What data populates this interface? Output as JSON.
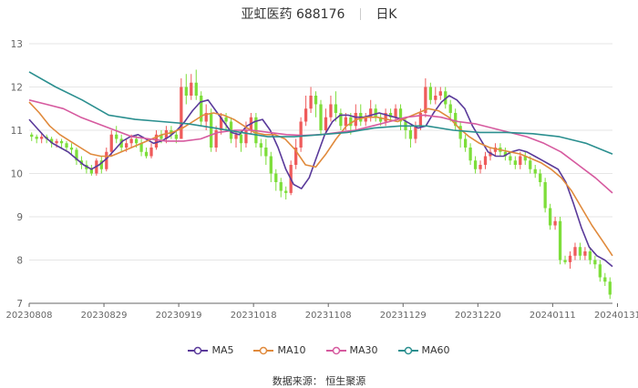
{
  "header": {
    "stock_name": "亚虹医药",
    "code": "688176",
    "period": "日K"
  },
  "source": "数据来源：  恒生聚源",
  "colors": {
    "up": "#ef5b5b",
    "down": "#7dde3a",
    "MA5": "#5a3a9a",
    "MA10": "#e08a3c",
    "MA30": "#d65a9f",
    "MA60": "#2b8f8f",
    "grid": "#e6e6e6",
    "axis": "#666666"
  },
  "chart_data": {
    "type": "candlestick",
    "title": "亚虹医药 688176 日K",
    "ylim": [
      7,
      13
    ],
    "yticks": [
      7,
      8,
      9,
      10,
      11,
      12,
      13
    ],
    "grid": true,
    "legend_position": "bottom",
    "x_tick_labels": [
      "20230808",
      "20230829",
      "20230919",
      "20231018",
      "20231108",
      "20231129",
      "20231220",
      "20240111",
      "20240131"
    ],
    "x_tick_index": [
      0,
      15,
      30,
      45,
      60,
      75,
      90,
      105,
      118
    ],
    "dates": [
      "20230808",
      "20230809",
      "20230810",
      "20230811",
      "20230814",
      "20230815",
      "20230816",
      "20230817",
      "20230818",
      "20230821",
      "20230822",
      "20230823",
      "20230824",
      "20230825",
      "20230828",
      "20230829",
      "20230830",
      "20230831",
      "20230901",
      "20230904",
      "20230905",
      "20230906",
      "20230907",
      "20230908",
      "20230911",
      "20230912",
      "20230913",
      "20230914",
      "20230915",
      "20230918",
      "20230919",
      "20230920",
      "20230921",
      "20230922",
      "20230925",
      "20230926",
      "20230927",
      "20230928",
      "20231009",
      "20231010",
      "20231011",
      "20231012",
      "20231013",
      "20231016",
      "20231017",
      "20231018",
      "20231019",
      "20231020",
      "20231023",
      "20231024",
      "20231025",
      "20231026",
      "20231027",
      "20231030",
      "20231031",
      "20231101",
      "20231102",
      "20231103",
      "20231106",
      "20231107",
      "20231108",
      "20231109",
      "20231110",
      "20231113",
      "20231114",
      "20231115",
      "20231116",
      "20231117",
      "20231120",
      "20231121",
      "20231122",
      "20231123",
      "20231124",
      "20231127",
      "20231128",
      "20231129",
      "20231130",
      "20231201",
      "20231204",
      "20231205",
      "20231206",
      "20231207",
      "20231208",
      "20231211",
      "20231212",
      "20231213",
      "20231214",
      "20231215",
      "20231218",
      "20231219",
      "20231220",
      "20231221",
      "20231222",
      "20231225",
      "20231226",
      "20231227",
      "20231228",
      "20231229",
      "20240102",
      "20240103",
      "20240104",
      "20240105",
      "20240108",
      "20240109",
      "20240110",
      "20240111",
      "20240112",
      "20240115",
      "20240116",
      "20240117",
      "20240118",
      "20240119",
      "20240122",
      "20240123",
      "20240124",
      "20240125",
      "20240126",
      "20240129",
      "20240131"
    ],
    "candles": [
      [
        10.9,
        10.85,
        10.95,
        10.75
      ],
      [
        10.85,
        10.8,
        10.9,
        10.7
      ],
      [
        10.8,
        10.85,
        10.95,
        10.7
      ],
      [
        10.85,
        10.8,
        10.9,
        10.7
      ],
      [
        10.8,
        10.7,
        10.85,
        10.6
      ],
      [
        10.7,
        10.75,
        10.8,
        10.6
      ],
      [
        10.75,
        10.7,
        10.8,
        10.6
      ],
      [
        10.7,
        10.6,
        10.75,
        10.5
      ],
      [
        10.6,
        10.55,
        10.7,
        10.45
      ],
      [
        10.55,
        10.3,
        10.6,
        10.2
      ],
      [
        10.3,
        10.2,
        10.4,
        10.1
      ],
      [
        10.2,
        10.1,
        10.3,
        10.0
      ],
      [
        10.1,
        10.0,
        10.2,
        9.95
      ],
      [
        10.0,
        10.3,
        10.35,
        9.95
      ],
      [
        10.3,
        10.1,
        10.4,
        10.0
      ],
      [
        10.1,
        10.5,
        10.6,
        10.05
      ],
      [
        10.5,
        10.9,
        11.0,
        10.4
      ],
      [
        10.9,
        10.8,
        11.1,
        10.7
      ],
      [
        10.8,
        10.6,
        10.9,
        10.5
      ],
      [
        10.6,
        10.7,
        10.8,
        10.5
      ],
      [
        10.7,
        10.8,
        10.9,
        10.6
      ],
      [
        10.8,
        10.7,
        10.9,
        10.6
      ],
      [
        10.7,
        10.5,
        10.8,
        10.4
      ],
      [
        10.5,
        10.4,
        10.6,
        10.35
      ],
      [
        10.4,
        10.6,
        10.7,
        10.35
      ],
      [
        10.6,
        10.9,
        11.0,
        10.55
      ],
      [
        10.9,
        10.8,
        11.0,
        10.7
      ],
      [
        10.8,
        11.0,
        11.1,
        10.7
      ],
      [
        11.0,
        10.9,
        11.1,
        10.8
      ],
      [
        10.9,
        10.8,
        11.0,
        10.7
      ],
      [
        10.8,
        12.0,
        12.2,
        10.8
      ],
      [
        12.0,
        11.8,
        12.3,
        11.6
      ],
      [
        11.8,
        12.1,
        12.3,
        11.7
      ],
      [
        12.1,
        11.8,
        12.4,
        11.7
      ],
      [
        11.8,
        11.2,
        11.9,
        11.1
      ],
      [
        11.2,
        11.4,
        11.6,
        11.0
      ],
      [
        11.4,
        10.6,
        11.5,
        10.5
      ],
      [
        10.6,
        11.0,
        11.1,
        10.5
      ],
      [
        11.0,
        11.3,
        11.4,
        10.9
      ],
      [
        11.3,
        11.2,
        11.4,
        11.0
      ],
      [
        11.2,
        10.8,
        11.3,
        10.7
      ],
      [
        10.8,
        10.9,
        11.0,
        10.6
      ],
      [
        10.9,
        10.7,
        11.0,
        10.5
      ],
      [
        10.7,
        11.0,
        11.2,
        10.6
      ],
      [
        11.0,
        11.3,
        11.4,
        10.9
      ],
      [
        11.3,
        10.7,
        11.4,
        10.6
      ],
      [
        10.7,
        10.6,
        10.8,
        10.4
      ],
      [
        10.6,
        10.4,
        10.8,
        10.2
      ],
      [
        10.4,
        10.0,
        10.5,
        9.8
      ],
      [
        10.0,
        9.8,
        10.1,
        9.6
      ],
      [
        9.8,
        9.6,
        9.9,
        9.45
      ],
      [
        9.6,
        9.55,
        9.7,
        9.4
      ],
      [
        9.55,
        10.2,
        10.3,
        9.5
      ],
      [
        10.2,
        10.6,
        10.8,
        10.1
      ],
      [
        10.6,
        11.2,
        11.3,
        10.5
      ],
      [
        11.2,
        11.5,
        11.8,
        11.1
      ],
      [
        11.5,
        11.8,
        12.0,
        11.4
      ],
      [
        11.8,
        11.6,
        11.9,
        11.3
      ],
      [
        11.6,
        11.0,
        11.7,
        10.9
      ],
      [
        11.0,
        11.3,
        11.5,
        10.9
      ],
      [
        11.3,
        11.6,
        11.8,
        11.2
      ],
      [
        11.6,
        11.4,
        11.9,
        11.2
      ],
      [
        11.4,
        11.1,
        11.5,
        11.0
      ],
      [
        11.1,
        11.3,
        11.4,
        11.0
      ],
      [
        11.3,
        11.1,
        11.4,
        10.9
      ],
      [
        11.1,
        11.4,
        11.6,
        11.0
      ],
      [
        11.4,
        11.2,
        11.6,
        11.1
      ],
      [
        11.2,
        11.3,
        11.4,
        11.1
      ],
      [
        11.3,
        11.5,
        11.7,
        11.2
      ],
      [
        11.5,
        11.3,
        11.6,
        11.2
      ],
      [
        11.3,
        11.2,
        11.4,
        11.1
      ],
      [
        11.2,
        11.4,
        11.5,
        11.1
      ],
      [
        11.4,
        11.3,
        11.5,
        11.2
      ],
      [
        11.3,
        11.5,
        11.6,
        11.2
      ],
      [
        11.5,
        11.2,
        11.6,
        11.0
      ],
      [
        11.2,
        11.0,
        11.3,
        10.8
      ],
      [
        11.0,
        10.8,
        11.1,
        10.6
      ],
      [
        10.8,
        11.1,
        11.2,
        10.7
      ],
      [
        11.1,
        11.4,
        11.5,
        11.0
      ],
      [
        11.4,
        12.0,
        12.2,
        11.3
      ],
      [
        12.0,
        11.7,
        12.1,
        11.6
      ],
      [
        11.7,
        11.8,
        12.0,
        11.6
      ],
      [
        11.8,
        11.9,
        12.0,
        11.7
      ],
      [
        11.9,
        11.6,
        12.0,
        11.5
      ],
      [
        11.6,
        11.4,
        11.7,
        11.2
      ],
      [
        11.4,
        11.1,
        11.5,
        11.0
      ],
      [
        11.1,
        10.8,
        11.2,
        10.6
      ],
      [
        10.8,
        10.6,
        10.9,
        10.5
      ],
      [
        10.6,
        10.3,
        10.7,
        10.2
      ],
      [
        10.3,
        10.1,
        10.4,
        10.0
      ],
      [
        10.1,
        10.2,
        10.3,
        10.0
      ],
      [
        10.2,
        10.4,
        10.5,
        10.1
      ],
      [
        10.4,
        10.5,
        10.6,
        10.3
      ],
      [
        10.5,
        10.6,
        10.7,
        10.4
      ],
      [
        10.6,
        10.5,
        10.7,
        10.4
      ],
      [
        10.5,
        10.4,
        10.6,
        10.3
      ],
      [
        10.4,
        10.3,
        10.5,
        10.2
      ],
      [
        10.3,
        10.2,
        10.4,
        10.1
      ],
      [
        10.2,
        10.4,
        10.5,
        10.1
      ],
      [
        10.4,
        10.3,
        10.5,
        10.2
      ],
      [
        10.3,
        10.1,
        10.4,
        10.0
      ],
      [
        10.1,
        10.0,
        10.2,
        9.9
      ],
      [
        10.0,
        9.8,
        10.1,
        9.7
      ],
      [
        9.8,
        9.2,
        9.9,
        9.1
      ],
      [
        9.2,
        8.8,
        9.3,
        8.7
      ],
      [
        8.8,
        8.9,
        9.0,
        8.7
      ],
      [
        8.9,
        8.0,
        9.0,
        7.9
      ],
      [
        8.0,
        7.95,
        8.1,
        7.9
      ],
      [
        7.95,
        8.1,
        8.2,
        7.8
      ],
      [
        8.1,
        8.3,
        8.4,
        8.0
      ],
      [
        8.3,
        8.1,
        8.4,
        8.0
      ],
      [
        8.1,
        8.2,
        8.3,
        8.0
      ],
      [
        8.2,
        8.0,
        8.3,
        7.9
      ],
      [
        8.0,
        7.9,
        8.1,
        7.8
      ],
      [
        7.9,
        7.6,
        8.0,
        7.5
      ],
      [
        7.6,
        7.5,
        7.7,
        7.4
      ],
      [
        7.5,
        7.2,
        7.6,
        7.1
      ]
    ],
    "series": [
      {
        "name": "MA5",
        "values": [
          11.25,
          11.05,
          10.85,
          10.7,
          10.6,
          10.5,
          10.35,
          10.2,
          10.1,
          10.2,
          10.35,
          10.55,
          10.75,
          10.85,
          10.9,
          10.8,
          10.7,
          10.75,
          10.85,
          11.0,
          11.2,
          11.45,
          11.65,
          11.7,
          11.45,
          11.2,
          10.95,
          10.9,
          11.1,
          11.2,
          11.25,
          11.0,
          10.6,
          10.1,
          9.75,
          9.65,
          9.9,
          10.4,
          10.9,
          11.2,
          11.35,
          11.35,
          11.3,
          11.3,
          11.35,
          11.4,
          11.35,
          11.3,
          11.25,
          11.15,
          11.05,
          11.1,
          11.4,
          11.65,
          11.8,
          11.7,
          11.5,
          11.1,
          10.8,
          10.5,
          10.4,
          10.4,
          10.5,
          10.55,
          10.5,
          10.4,
          10.3,
          10.2,
          10.1,
          9.8,
          9.3,
          8.75,
          8.3,
          8.1,
          8.0,
          7.85
        ]
      },
      {
        "name": "MA10",
        "values": [
          11.65,
          11.4,
          11.1,
          10.9,
          10.75,
          10.6,
          10.45,
          10.4,
          10.4,
          10.5,
          10.6,
          10.7,
          10.8,
          10.9,
          10.95,
          11.05,
          11.2,
          11.35,
          11.4,
          11.35,
          11.25,
          11.1,
          10.95,
          10.9,
          10.9,
          10.8,
          10.55,
          10.2,
          10.15,
          10.45,
          10.8,
          11.1,
          11.25,
          11.3,
          11.3,
          11.25,
          11.2,
          11.3,
          11.4,
          11.5,
          11.45,
          11.3,
          11.05,
          10.85,
          10.7,
          10.6,
          10.55,
          10.5,
          10.45,
          10.35,
          10.25,
          10.1,
          9.9,
          9.6,
          9.2,
          8.8,
          8.45,
          8.1
        ]
      },
      {
        "name": "MA30",
        "values": [
          11.7,
          11.6,
          11.5,
          11.3,
          11.15,
          11.0,
          10.85,
          10.8,
          10.75,
          10.75,
          10.8,
          10.95,
          11.0,
          11.0,
          10.95,
          10.9,
          10.88,
          10.9,
          10.95,
          11.0,
          11.1,
          11.2,
          11.3,
          11.35,
          11.3,
          11.2,
          11.15,
          11.05,
          10.95,
          10.85,
          10.7,
          10.5,
          10.2,
          9.9,
          9.55
        ]
      },
      {
        "name": "MA60",
        "values": [
          12.35,
          12.0,
          11.7,
          11.35,
          11.25,
          11.2,
          11.15,
          11.05,
          10.95,
          10.85,
          10.85,
          10.9,
          10.95,
          11.05,
          11.1,
          11.1,
          11.0,
          10.95,
          10.95,
          10.92,
          10.85,
          10.7,
          10.45
        ]
      }
    ]
  }
}
